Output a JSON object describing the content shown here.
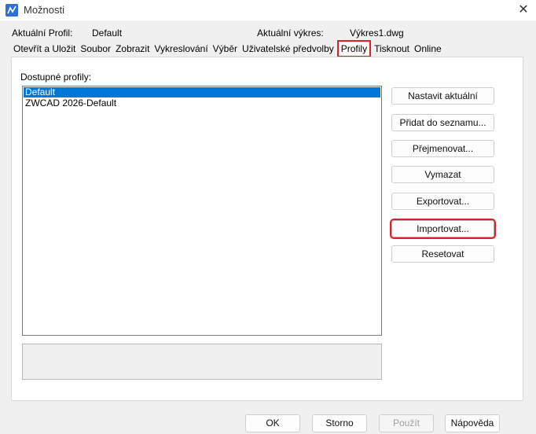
{
  "window": {
    "title": "Možnosti",
    "close_symbol": "✕"
  },
  "info": {
    "profile_label": "Aktuální Profil:",
    "profile_value": "Default",
    "drawing_label": "Aktuální výkres:",
    "drawing_value": "Výkres1.dwg"
  },
  "tabs": [
    {
      "label": "Otevřít a Uložit"
    },
    {
      "label": "Soubor"
    },
    {
      "label": "Zobrazit"
    },
    {
      "label": "Vykreslování"
    },
    {
      "label": "Výběr"
    },
    {
      "label": "Uživatelské předvolby"
    },
    {
      "label": "Profily",
      "active": true
    },
    {
      "label": "Tisknout"
    },
    {
      "label": "Online"
    }
  ],
  "profiles": {
    "label": "Dostupné profily:",
    "items": [
      {
        "label": "Default",
        "selected": true
      },
      {
        "label": "ZWCAD 2026-Default"
      }
    ]
  },
  "side_buttons": {
    "set_current": "Nastavit aktuální",
    "add_to_list": "Přidat do seznamu...",
    "rename": "Přejmenovat...",
    "delete": "Vymazat",
    "export": "Exportovat...",
    "import": "Importovat...",
    "reset": "Resetovat"
  },
  "bottom_buttons": {
    "ok": "OK",
    "cancel": "Storno",
    "apply": "Použít",
    "help": "Nápověda"
  },
  "colors": {
    "selection": "#0078d7",
    "highlight_box": "#d8232a"
  },
  "icons": {
    "app": "zwcad-app-icon",
    "close": "close-icon"
  }
}
